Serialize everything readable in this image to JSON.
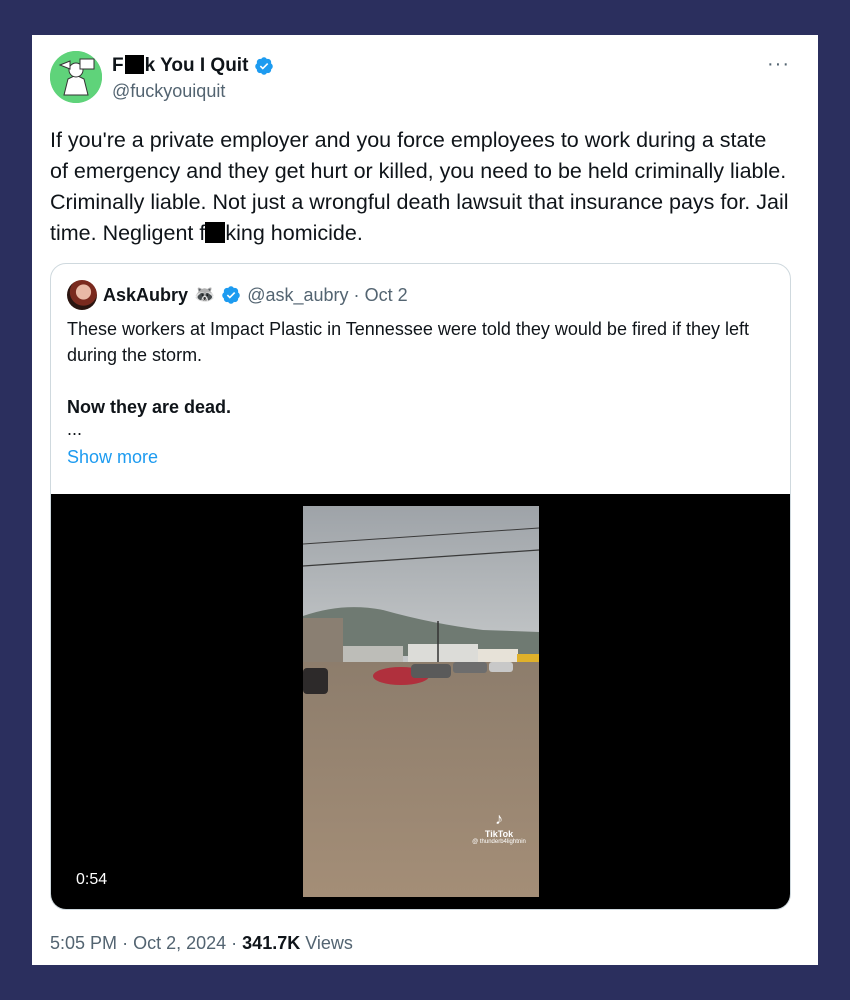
{
  "author": {
    "name_prefix": "F",
    "name_suffix": "k You I Quit",
    "handle": "@fuckyouiquit",
    "verified_color": "#1d9bf0"
  },
  "more_icon": "···",
  "tweet": {
    "text_before": "If you're a private employer and you force employees to work during a state of emergency and they get hurt or killed, you need to be held criminally liable. Criminally liable. Not just a wrongful death lawsuit that insurance pays for. Jail time. Negligent f",
    "text_after": "king homicide."
  },
  "quote": {
    "name": "AskAubry",
    "emoji": "🦝",
    "handle": "@ask_aubry",
    "separator": "·",
    "date": "Oct 2",
    "paragraph1": "These workers at Impact Plastic in Tennessee were told they would be fired if they left during the storm.",
    "paragraph2": "Now they are dead.",
    "ellipsis": "...",
    "show_more": "Show more"
  },
  "video": {
    "duration": "0:54",
    "watermark_brand": "TikTok",
    "watermark_user": "@ thunderb4lightnin"
  },
  "footer": {
    "time": "5:05 PM",
    "sep1": "·",
    "date": "Oct 2, 2024",
    "sep2": "·",
    "views_count": "341.7K",
    "views_label": "Views"
  },
  "colors": {
    "background": "#2b2f5e",
    "accent_blue": "#1d9bf0",
    "text_secondary": "#536471",
    "avatar_green": "#5fd37a"
  }
}
